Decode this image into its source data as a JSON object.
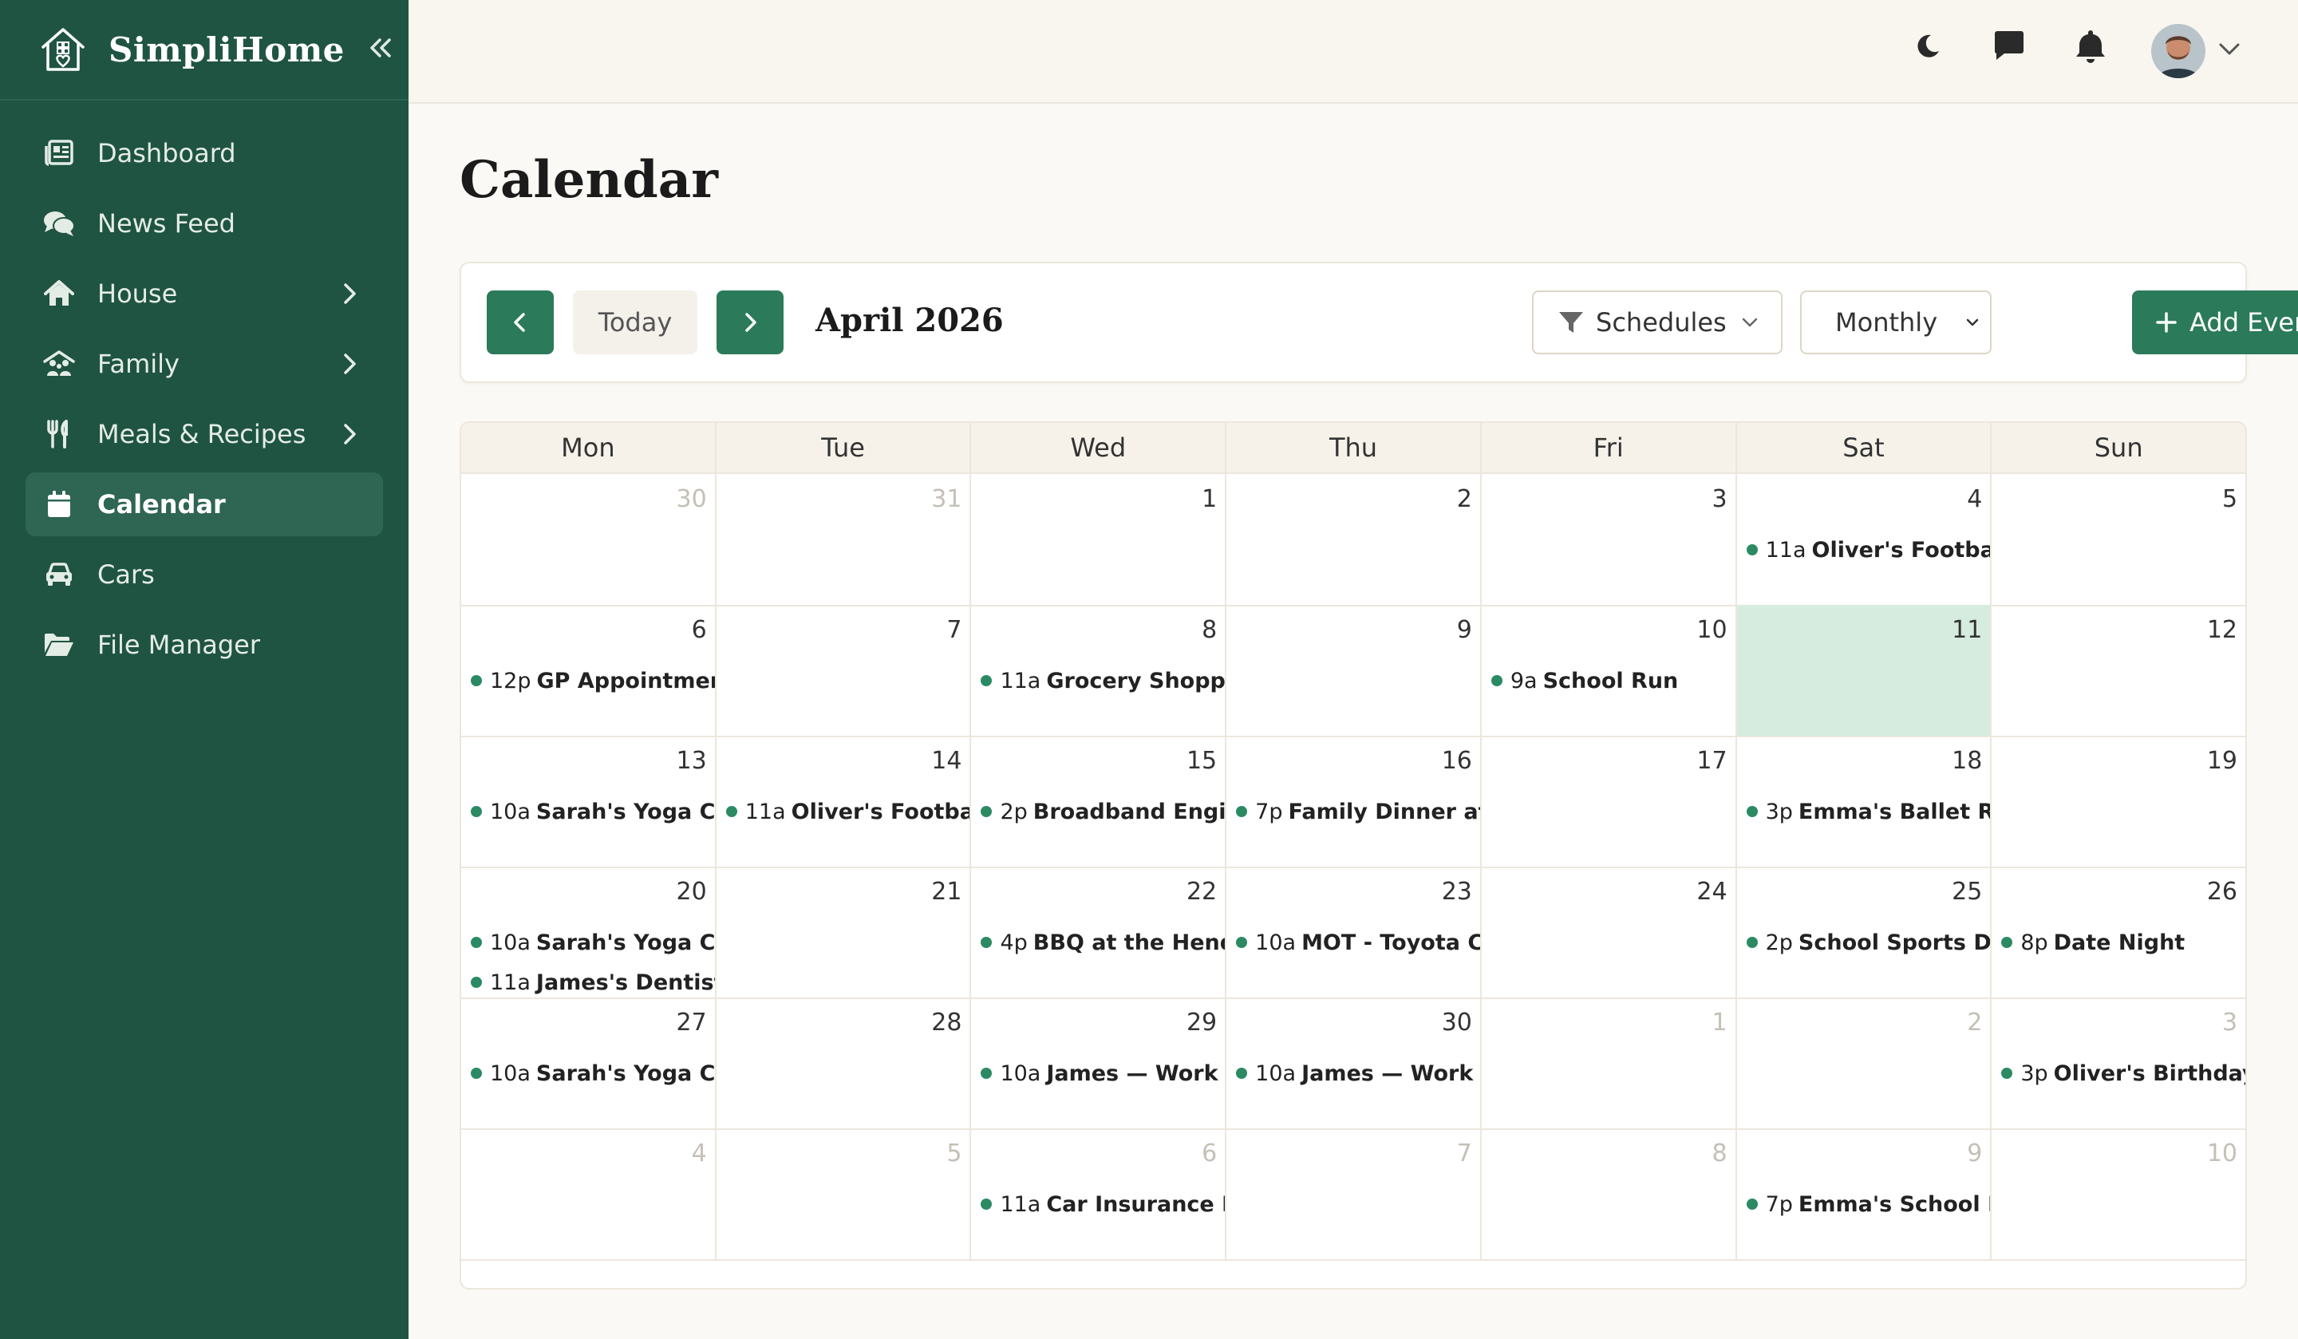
{
  "brand": {
    "name": "SimpliHome"
  },
  "nav": [
    {
      "label": "Dashboard",
      "icon": "dashboard-icon",
      "chevron": false,
      "active": false
    },
    {
      "label": "News Feed",
      "icon": "comments-icon",
      "chevron": false,
      "active": false
    },
    {
      "label": "House",
      "icon": "house-icon",
      "chevron": true,
      "active": false
    },
    {
      "label": "Family",
      "icon": "family-icon",
      "chevron": true,
      "active": false
    },
    {
      "label": "Meals & Recipes",
      "icon": "utensils-icon",
      "chevron": true,
      "active": false
    },
    {
      "label": "Calendar",
      "icon": "calendar-icon",
      "chevron": false,
      "active": true
    },
    {
      "label": "Cars",
      "icon": "car-icon",
      "chevron": false,
      "active": false
    },
    {
      "label": "File Manager",
      "icon": "folder-icon",
      "chevron": false,
      "active": false
    }
  ],
  "page": {
    "title": "Calendar"
  },
  "toolbar": {
    "today_label": "Today",
    "month_label": "April 2026",
    "schedules_label": "Schedules",
    "view_label": "Monthly",
    "add_label": "Add Event"
  },
  "calendar": {
    "weekdays": [
      "Mon",
      "Tue",
      "Wed",
      "Thu",
      "Fri",
      "Sat",
      "Sun"
    ],
    "weeks": [
      [
        {
          "d": "30",
          "other": true,
          "events": []
        },
        {
          "d": "31",
          "other": true,
          "events": []
        },
        {
          "d": "1",
          "events": []
        },
        {
          "d": "2",
          "events": []
        },
        {
          "d": "3",
          "events": []
        },
        {
          "d": "4",
          "events": [
            {
              "time": "11a",
              "title": "Oliver's Football M"
            }
          ]
        },
        {
          "d": "5",
          "events": []
        }
      ],
      [
        {
          "d": "6",
          "events": [
            {
              "time": "12p",
              "title": "GP Appointment -"
            }
          ]
        },
        {
          "d": "7",
          "events": []
        },
        {
          "d": "8",
          "events": [
            {
              "time": "11a",
              "title": "Grocery Shopping"
            }
          ]
        },
        {
          "d": "9",
          "events": []
        },
        {
          "d": "10",
          "events": [
            {
              "time": "9a",
              "title": "School Run"
            }
          ]
        },
        {
          "d": "11",
          "today": true,
          "events": []
        },
        {
          "d": "12",
          "events": []
        }
      ],
      [
        {
          "d": "13",
          "events": [
            {
              "time": "10a",
              "title": "Sarah's Yoga Class"
            }
          ]
        },
        {
          "d": "14",
          "events": [
            {
              "time": "11a",
              "title": "Oliver's Football M"
            }
          ]
        },
        {
          "d": "15",
          "events": [
            {
              "time": "2p",
              "title": "Broadband Engine"
            }
          ]
        },
        {
          "d": "16",
          "events": [
            {
              "time": "7p",
              "title": "Family Dinner at G"
            }
          ]
        },
        {
          "d": "17",
          "events": []
        },
        {
          "d": "18",
          "events": [
            {
              "time": "3p",
              "title": "Emma's Ballet Rec"
            }
          ]
        },
        {
          "d": "19",
          "events": []
        }
      ],
      [
        {
          "d": "20",
          "events": [
            {
              "time": "10a",
              "title": "Sarah's Yoga Class"
            },
            {
              "time": "11a",
              "title": "James's Dentist Ap"
            }
          ]
        },
        {
          "d": "21",
          "events": []
        },
        {
          "d": "22",
          "events": [
            {
              "time": "4p",
              "title": "BBQ at the Hender"
            }
          ]
        },
        {
          "d": "23",
          "events": [
            {
              "time": "10a",
              "title": "MOT - Toyota Cor"
            }
          ]
        },
        {
          "d": "24",
          "events": []
        },
        {
          "d": "25",
          "events": [
            {
              "time": "2p",
              "title": "School Sports Day"
            }
          ]
        },
        {
          "d": "26",
          "events": [
            {
              "time": "8p",
              "title": "Date Night"
            }
          ]
        }
      ],
      [
        {
          "d": "27",
          "events": [
            {
              "time": "10a",
              "title": "Sarah's Yoga Class"
            }
          ]
        },
        {
          "d": "28",
          "events": []
        },
        {
          "d": "29",
          "events": [
            {
              "time": "10a",
              "title": "James — Work Co"
            }
          ]
        },
        {
          "d": "30",
          "events": [
            {
              "time": "10a",
              "title": "James — Work Co"
            }
          ]
        },
        {
          "d": "1",
          "other": true,
          "events": []
        },
        {
          "d": "2",
          "other": true,
          "events": []
        },
        {
          "d": "3",
          "other": true,
          "events": [
            {
              "time": "3p",
              "title": "Oliver's Birthday P"
            }
          ]
        }
      ],
      [
        {
          "d": "4",
          "other": true,
          "events": []
        },
        {
          "d": "5",
          "other": true,
          "events": []
        },
        {
          "d": "6",
          "other": true,
          "events": [
            {
              "time": "11a",
              "title": "Car Insurance Ren"
            }
          ]
        },
        {
          "d": "7",
          "other": true,
          "events": []
        },
        {
          "d": "8",
          "other": true,
          "events": []
        },
        {
          "d": "9",
          "other": true,
          "events": [
            {
              "time": "7p",
              "title": "Emma's School Pla"
            }
          ]
        },
        {
          "d": "10",
          "other": true,
          "events": []
        }
      ]
    ]
  },
  "colors": {
    "sidebar": "#1f5442",
    "accent": "#2b7a5a",
    "today": "#d6ecdf",
    "event_dot": "#2b8a64"
  }
}
